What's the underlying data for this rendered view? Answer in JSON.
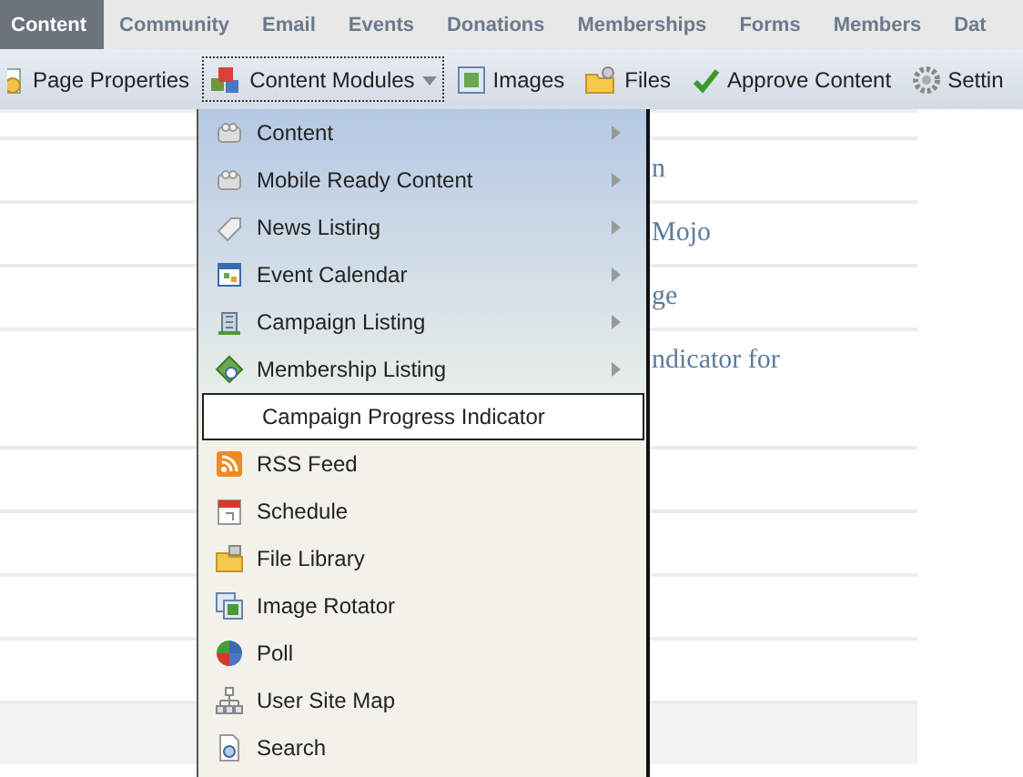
{
  "nav_tabs": [
    {
      "label": "Content",
      "selected": true
    },
    {
      "label": "Community",
      "selected": false
    },
    {
      "label": "Email",
      "selected": false
    },
    {
      "label": "Events",
      "selected": false
    },
    {
      "label": "Donations",
      "selected": false
    },
    {
      "label": "Memberships",
      "selected": false
    },
    {
      "label": "Forms",
      "selected": false
    },
    {
      "label": "Members",
      "selected": false
    },
    {
      "label": "Dat",
      "selected": false
    }
  ],
  "toolbar": [
    {
      "kind": "page",
      "label": "Page Properties",
      "open": false
    },
    {
      "kind": "modules",
      "label": "Content Modules",
      "open": true
    },
    {
      "kind": "images",
      "label": "Images",
      "open": false
    },
    {
      "kind": "files",
      "label": "Files",
      "open": false
    },
    {
      "kind": "approve",
      "label": "Approve Content",
      "open": false
    },
    {
      "kind": "settings",
      "label": "Settin",
      "open": false
    }
  ],
  "dropdown_menu": {
    "items": [
      {
        "label": "Content",
        "has_submenu": true,
        "selected": false
      },
      {
        "label": "Mobile Ready Content",
        "has_submenu": true,
        "selected": false
      },
      {
        "label": "News Listing",
        "has_submenu": true,
        "selected": false
      },
      {
        "label": "Event Calendar",
        "has_submenu": true,
        "selected": false
      },
      {
        "label": "Campaign Listing",
        "has_submenu": true,
        "selected": false
      },
      {
        "label": "Membership Listing",
        "has_submenu": true,
        "selected": false
      },
      {
        "label": "Campaign Progress Indicator",
        "has_submenu": false,
        "selected": true
      },
      {
        "label": "RSS Feed",
        "has_submenu": false,
        "selected": false
      },
      {
        "label": "Schedule",
        "has_submenu": false,
        "selected": false
      },
      {
        "label": "File Library",
        "has_submenu": false,
        "selected": false
      },
      {
        "label": "Image Rotator",
        "has_submenu": false,
        "selected": false
      },
      {
        "label": "Poll",
        "has_submenu": false,
        "selected": false
      },
      {
        "label": "User Site Map",
        "has_submenu": false,
        "selected": false
      },
      {
        "label": "Search",
        "has_submenu": false,
        "selected": false
      }
    ]
  },
  "page_list": {
    "rows": [
      {
        "text": "n"
      },
      {
        "text": "Mojo"
      },
      {
        "text": "ge"
      },
      {
        "text": "ndicator for"
      }
    ]
  }
}
